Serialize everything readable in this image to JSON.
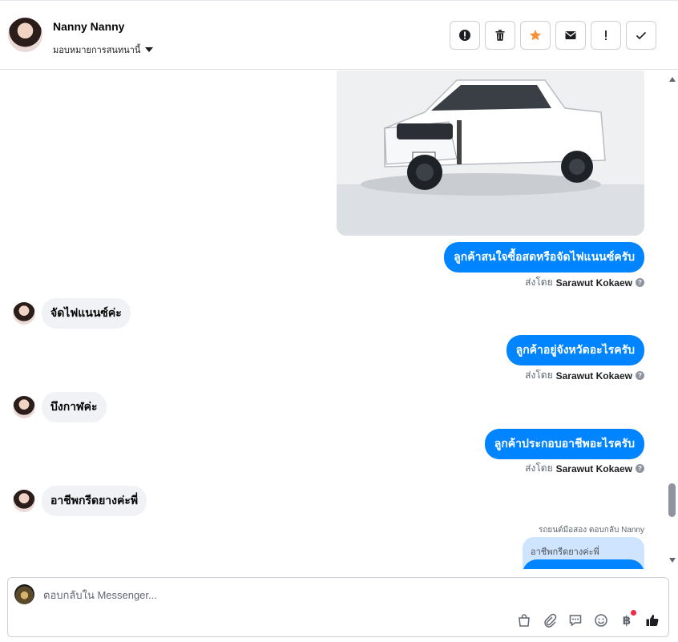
{
  "header": {
    "contact_name": "Nanny Nanny",
    "assign_label": "มอบหมายการสนทนานี้",
    "actions": [
      {
        "icon": "alert-circle-icon"
      },
      {
        "icon": "trash-icon"
      },
      {
        "icon": "star-icon",
        "color": "#f7923a"
      },
      {
        "icon": "envelope-icon"
      },
      {
        "icon": "exclamation-icon"
      },
      {
        "icon": "check-icon"
      }
    ]
  },
  "messages": {
    "out1": "ลูกค้าสนใจซื้อสดหรือจัดไฟแนนซ์ครับ",
    "in1": "จัดไฟแนนซ์ค่ะ",
    "out2": "ลูกค้าอยู่จังหวัดอะไรครับ",
    "in2": "บึงกาฬค่ะ",
    "out3": "ลูกค้าประกอบอาชีพอะไรครับ",
    "in3": "อาชีพกรีดยางค่ะพี่",
    "sent_by_prefix": "ส่งโดย",
    "sender": "Sarawut Kokaew",
    "reply_note": "รถยนต์มือสอง ตอบกลับ Nanny",
    "reply_quote": "อาชีพกรีดยางค่ะพี่"
  },
  "composer": {
    "placeholder": "ตอบกลับใน Messenger...",
    "tools": [
      "bag-icon",
      "paperclip-icon",
      "saved-reply-icon",
      "emoji-icon",
      "baht-icon",
      "thumbs-up-icon"
    ]
  },
  "colors": {
    "outgoing_bubble": "#0084ff",
    "incoming_bubble": "#f0f2f5",
    "star": "#f7923a",
    "notification_dot": "#f02849"
  }
}
